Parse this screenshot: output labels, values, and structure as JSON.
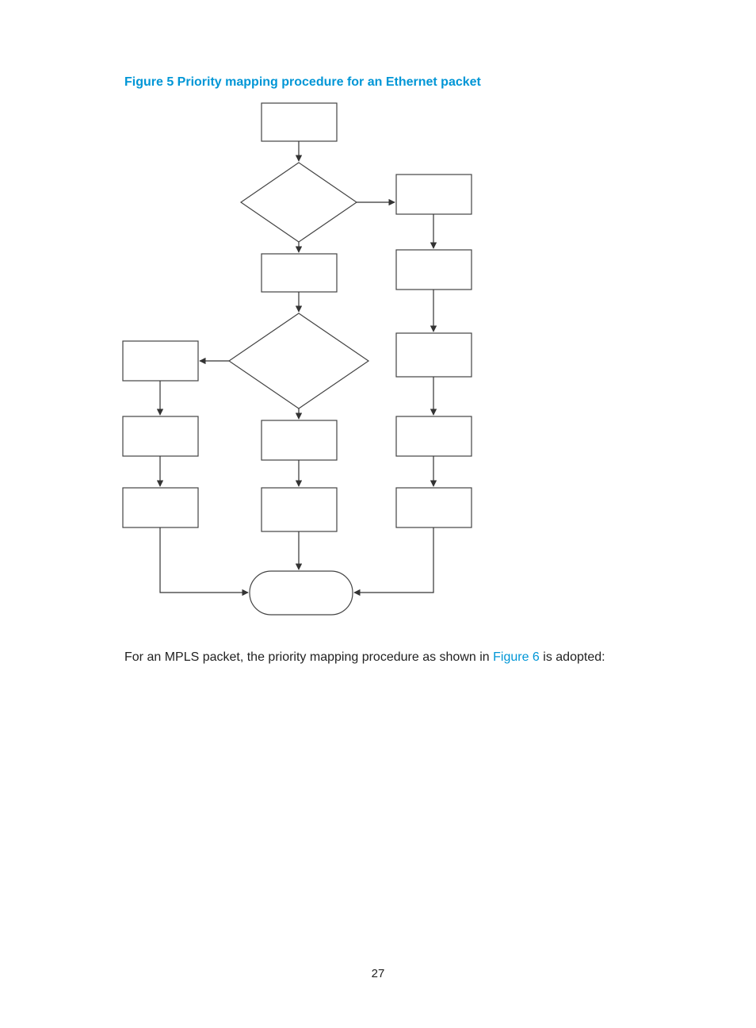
{
  "figure_title": "Figure 5 Priority mapping procedure for an Ethernet packet",
  "caption_prefix": "For an MPLS packet, the priority mapping procedure as shown in ",
  "caption_link": "Figure 6",
  "caption_suffix": " is adopted:",
  "page_number": "27",
  "chart_data": {
    "type": "flowchart",
    "title": "Priority mapping procedure for an Ethernet packet",
    "nodes": [
      {
        "id": "n1",
        "kind": "process",
        "text": ""
      },
      {
        "id": "d1",
        "kind": "decision",
        "text": ""
      },
      {
        "id": "n2",
        "kind": "process",
        "text": ""
      },
      {
        "id": "d2",
        "kind": "decision",
        "text": ""
      },
      {
        "id": "n3a",
        "kind": "process",
        "text": ""
      },
      {
        "id": "n4a",
        "kind": "process",
        "text": ""
      },
      {
        "id": "n5a",
        "kind": "process",
        "text": ""
      },
      {
        "id": "n3b",
        "kind": "process",
        "text": ""
      },
      {
        "id": "n4b",
        "kind": "process",
        "text": ""
      },
      {
        "id": "n3c",
        "kind": "process",
        "text": ""
      },
      {
        "id": "n4c",
        "kind": "process",
        "text": ""
      },
      {
        "id": "n5c",
        "kind": "process",
        "text": ""
      },
      {
        "id": "n6c",
        "kind": "process",
        "text": ""
      },
      {
        "id": "end",
        "kind": "terminator",
        "text": ""
      }
    ],
    "edges": [
      {
        "from": "n1",
        "to": "d1",
        "label": ""
      },
      {
        "from": "d1",
        "to": "n3c",
        "label": ""
      },
      {
        "from": "d1",
        "to": "n2",
        "label": ""
      },
      {
        "from": "n2",
        "to": "d2",
        "label": ""
      },
      {
        "from": "d2",
        "to": "n3a",
        "label": ""
      },
      {
        "from": "d2",
        "to": "n3b",
        "label": ""
      },
      {
        "from": "n3a",
        "to": "n4a",
        "label": ""
      },
      {
        "from": "n4a",
        "to": "n5a",
        "label": ""
      },
      {
        "from": "n5a",
        "to": "end",
        "label": ""
      },
      {
        "from": "n3b",
        "to": "n4b",
        "label": ""
      },
      {
        "from": "n4b",
        "to": "end",
        "label": ""
      },
      {
        "from": "n3c",
        "to": "n4c",
        "label": ""
      },
      {
        "from": "n4c",
        "to": "n5c",
        "label": ""
      },
      {
        "from": "n5c",
        "to": "n6c",
        "label": ""
      },
      {
        "from": "n6c",
        "to": "end",
        "label": ""
      }
    ]
  }
}
